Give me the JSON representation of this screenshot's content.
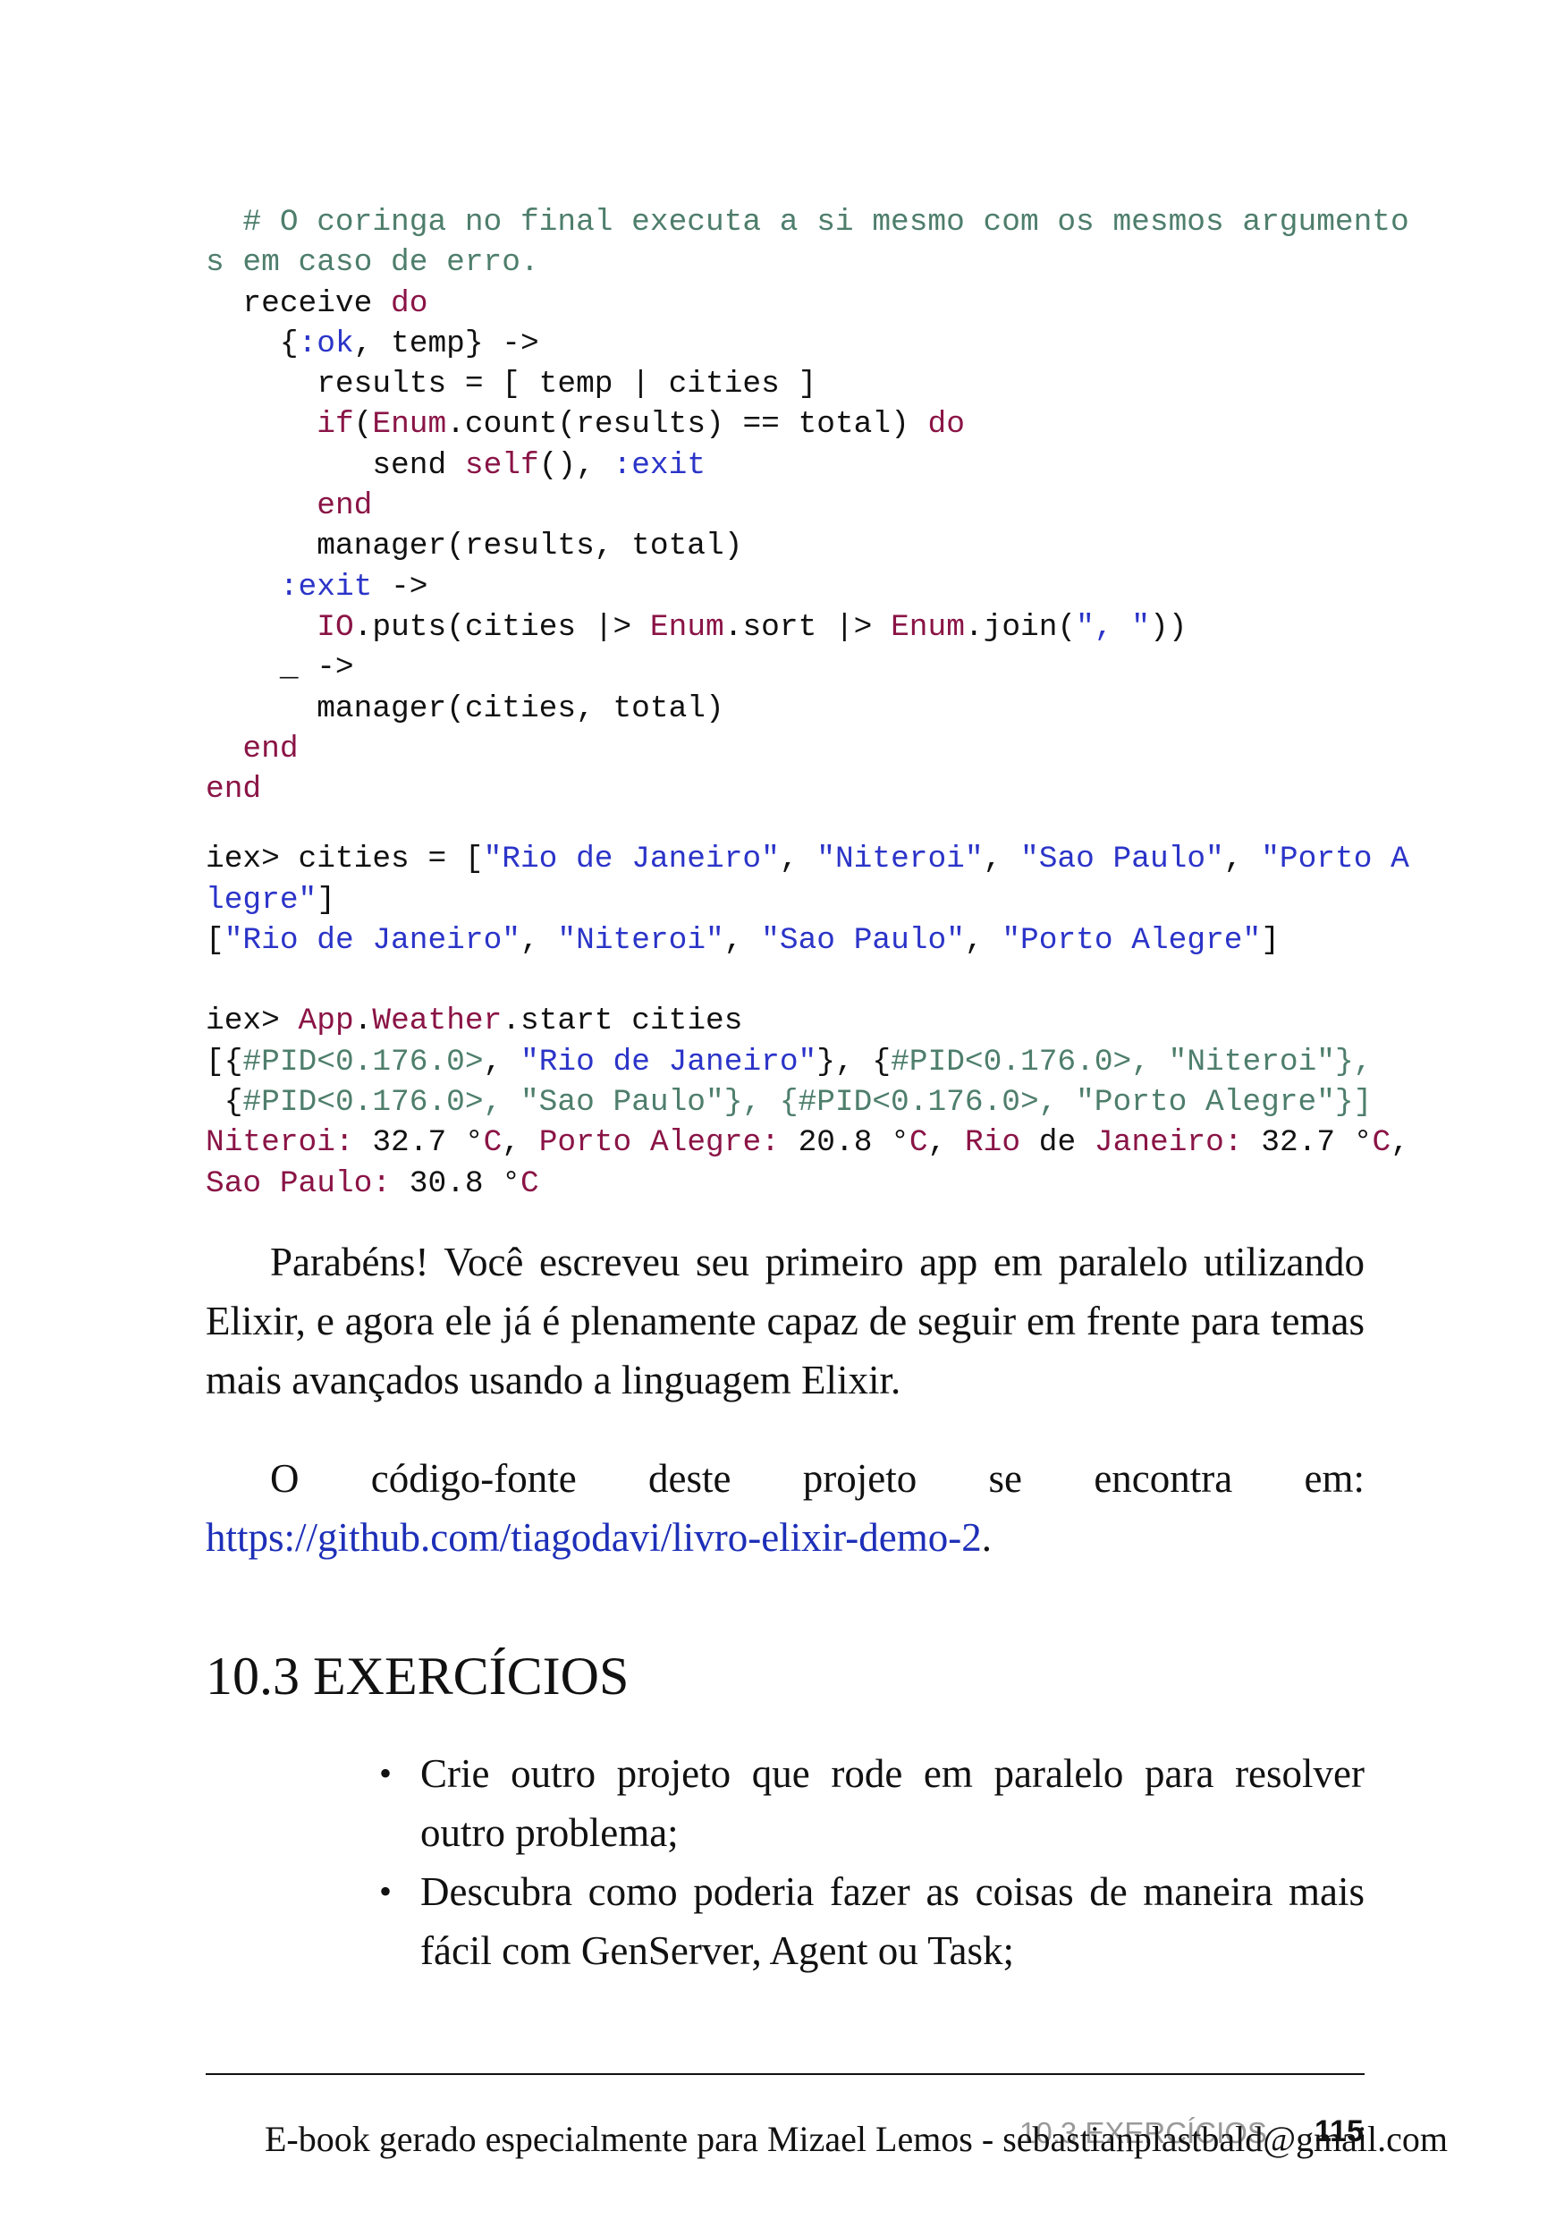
{
  "code": {
    "l1": "  # O coringa no final executa a si mesmo com os mesmos argumento",
    "l2": "s em caso de erro.",
    "l3a": "  receive ",
    "l3b": "do",
    "l4a": "    {",
    "l4b": ":ok",
    "l4c": ", temp} ->",
    "l5": "      results = [ temp | cities ]",
    "l6a": "      ",
    "l6b": "if",
    "l6c": "(",
    "l6d": "Enum",
    "l6e": ".count(results) == total) ",
    "l6f": "do",
    "l7a": "         send ",
    "l7b": "self",
    "l7c": "(), ",
    "l7d": ":exit",
    "l8a": "      ",
    "l8b": "end",
    "l9": "      manager(results, total)",
    "l10a": "    ",
    "l10b": ":exit",
    "l10c": " ->",
    "l11a": "      ",
    "l11b": "IO",
    "l11c": ".puts(cities |> ",
    "l11d": "Enum",
    "l11e": ".sort |> ",
    "l11f": "Enum",
    "l11g": ".join(",
    "l11h": "\", \"",
    "l11i": "))",
    "l12": "    _ ->",
    "l13": "      manager(cities, total)",
    "l14a": "  ",
    "l14b": "end",
    "l15": "end",
    "l16a": "iex> cities = [",
    "l16b": "\"Rio de Janeiro\"",
    "l16c": ", ",
    "l16d": "\"Niteroi\"",
    "l16e": ", ",
    "l16f": "\"Sao Paulo\"",
    "l16g": ", ",
    "l16h": "\"Porto A",
    "l17a": "legre\"",
    "l17b": "]",
    "l18a": "[",
    "l18b": "\"Rio de Janeiro\"",
    "l18c": ", ",
    "l18d": "\"Niteroi\"",
    "l18e": ", ",
    "l18f": "\"Sao Paulo\"",
    "l18g": ", ",
    "l18h": "\"Porto Alegre\"",
    "l18i": "]",
    "l19a": "iex> ",
    "l19b": "App",
    "l19c": ".",
    "l19d": "Weather",
    "l19e": ".start cities",
    "l20a": "[{",
    "l20b": "#PID<0.176.0>",
    "l20c": ", ",
    "l20d": "\"Rio de Janeiro\"",
    "l20e": "}, {",
    "l20f": "#PID<0.176.0>, \"Niteroi\"},",
    "l21a": " {",
    "l21b": "#PID<0.176.0>, \"Sao Paulo\"}, {#PID<0.176.0>, \"Porto Alegre\"}]",
    "l22a": "Niteroi:",
    "l22b": " 32.7 °",
    "l22c": "C",
    "l22d": ", ",
    "l22e": "Porto Alegre:",
    "l22f": " 20.8 °",
    "l22g": "C",
    "l22h": ", ",
    "l22i": "Rio",
    "l22j": " de ",
    "l22k": "Janeiro:",
    "l22l": " 32.7 °",
    "l22m": "C",
    "l22n": ",",
    "l23a": "Sao Paulo:",
    "l23b": " 30.8 °",
    "l23c": "C"
  },
  "paragraph1": "Parabéns! Você escreveu seu primeiro app em paralelo utilizando Elixir, e agora ele já é plenamente capaz de seguir em frente para temas mais avançados usando a linguagem Elixir.",
  "paragraph2_text": "O código-fonte deste projeto se encontra em: ",
  "paragraph2_link": "https://github.com/tiagodavi/livro-elixir-demo-2",
  "paragraph2_end": ".",
  "section_heading": "10.3 EXERCÍCIOS",
  "bullets": [
    "Crie outro projeto que rode em paralelo para resolver outro problema;",
    "Descubra como poderia fazer as coisas de maneira mais fácil com GenServer, Agent ou Task;"
  ],
  "footer": {
    "running_header": "10.3 EXERCÍCIOS",
    "page_number": "115",
    "ebook_notice": "E-book gerado especialmente para Mizael Lemos - sebastianplastbald@gmail.com"
  },
  "colors": {
    "comment": "#4e7e6c",
    "keyword": "#8a1446",
    "atom_string": "#2b34c8",
    "link": "#1d2fb8"
  }
}
